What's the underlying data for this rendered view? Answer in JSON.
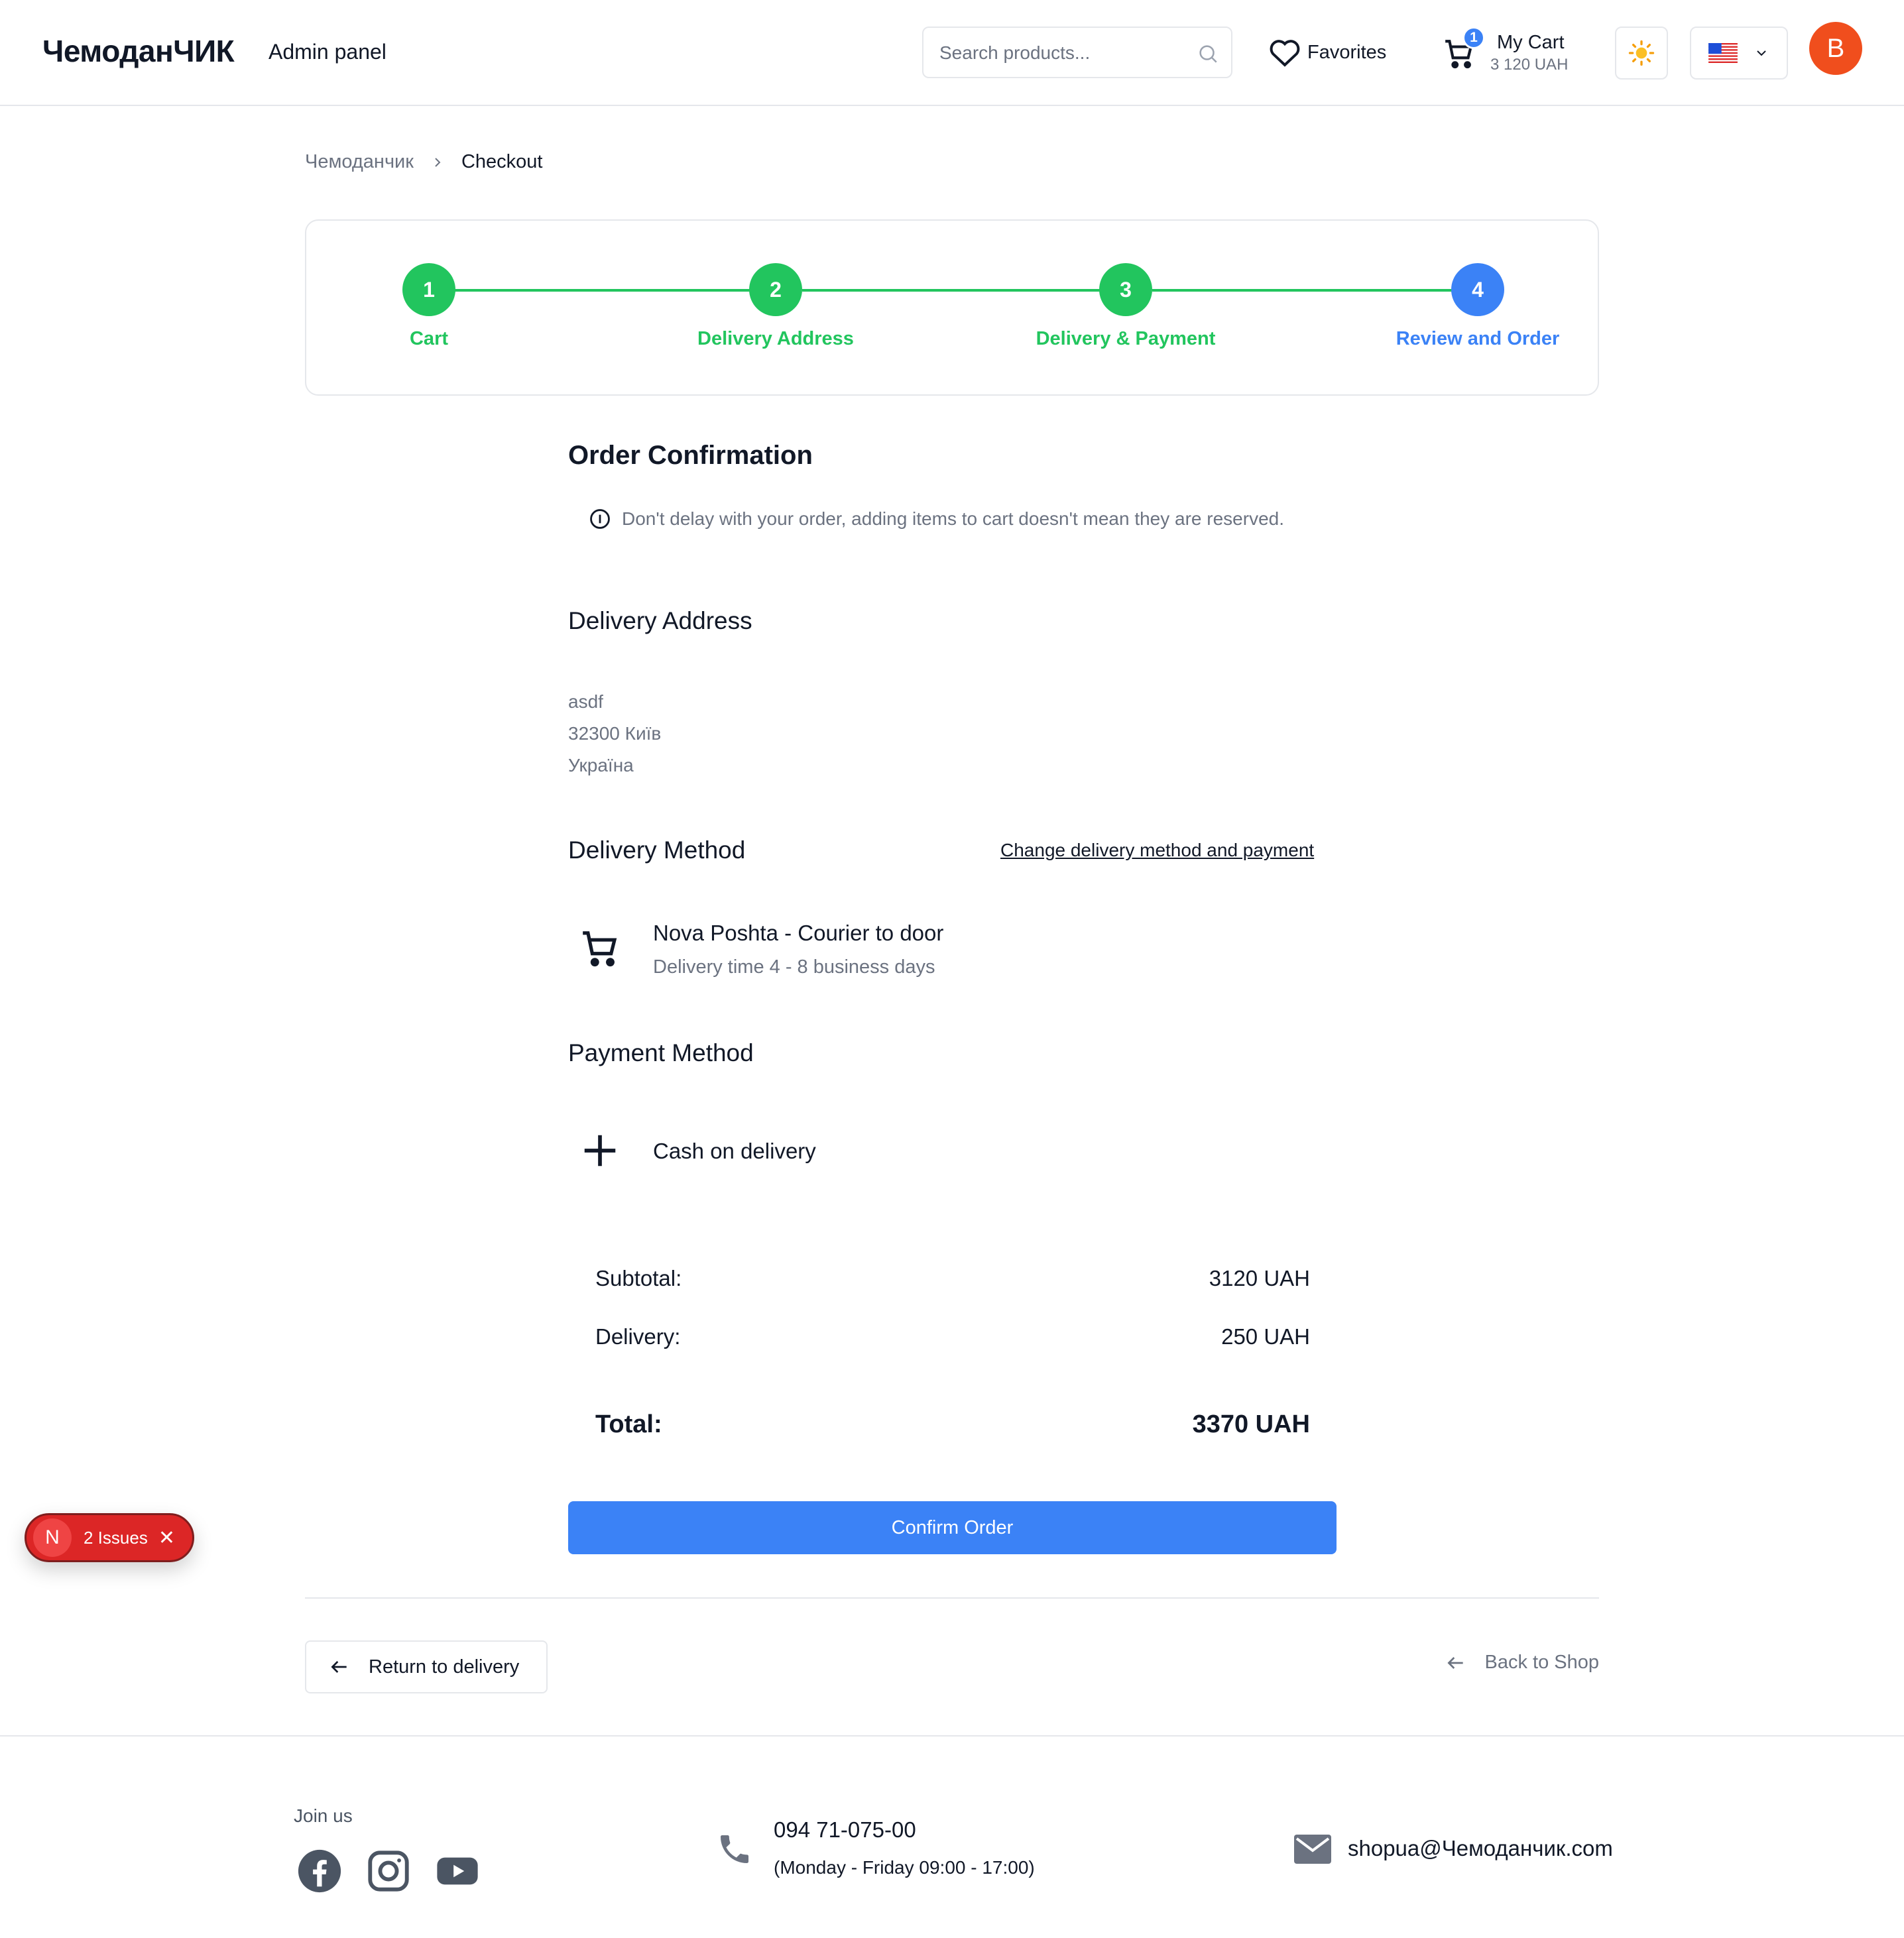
{
  "header": {
    "logo": "ЧемоданЧИК",
    "admin_link": "Admin panel",
    "search_placeholder": "Search products...",
    "favorites_label": "Favorites",
    "cart_badge": "1",
    "cart_title": "My Cart",
    "cart_total": "3 120 UAH",
    "avatar_initial": "B"
  },
  "breadcrumb": {
    "home": "Чемоданчик",
    "current": "Checkout"
  },
  "stepper": {
    "steps": [
      {
        "number": "1",
        "label": "Cart",
        "state": "done"
      },
      {
        "number": "2",
        "label": "Delivery Address",
        "state": "done"
      },
      {
        "number": "3",
        "label": "Delivery & Payment",
        "state": "done"
      },
      {
        "number": "4",
        "label": "Review and Order",
        "state": "active"
      }
    ]
  },
  "order": {
    "title": "Order Confirmation",
    "notice": "Don't delay with your order, adding items to cart doesn't mean they are reserved.",
    "delivery_address": {
      "heading": "Delivery Address",
      "lines": [
        "asdf",
        "32300 Київ",
        "Україна"
      ]
    },
    "delivery_method": {
      "heading": "Delivery Method",
      "change_link": "Change delivery method and payment",
      "name": "Nova Poshta - Courier to door",
      "description": "Delivery time 4 - 8 business days"
    },
    "payment_method": {
      "heading": "Payment Method",
      "name": "Cash on delivery"
    },
    "summary": {
      "subtotal_label": "Subtotal:",
      "subtotal_value": "3120 UAH",
      "delivery_label": "Delivery:",
      "delivery_value": "250 UAH",
      "total_label": "Total:",
      "total_value": "3370 UAH"
    },
    "confirm_label": "Confirm Order"
  },
  "navigation": {
    "return_label": "Return to delivery",
    "back_shop_label": "Back to Shop"
  },
  "issues": {
    "logo": "N",
    "label": "2 Issues"
  },
  "footer": {
    "join_label": "Join us",
    "social": [
      "facebook-icon",
      "instagram-icon",
      "youtube-icon"
    ],
    "phone": "094 71-075-00",
    "hours": "(Monday - Friday 09:00 - 17:00)",
    "email": "shopua@Чемоданчик.com"
  },
  "colors": {
    "primary": "#3b82f6",
    "success": "#22c55e",
    "avatar": "#f04e1d",
    "issues": "#dc2626"
  }
}
